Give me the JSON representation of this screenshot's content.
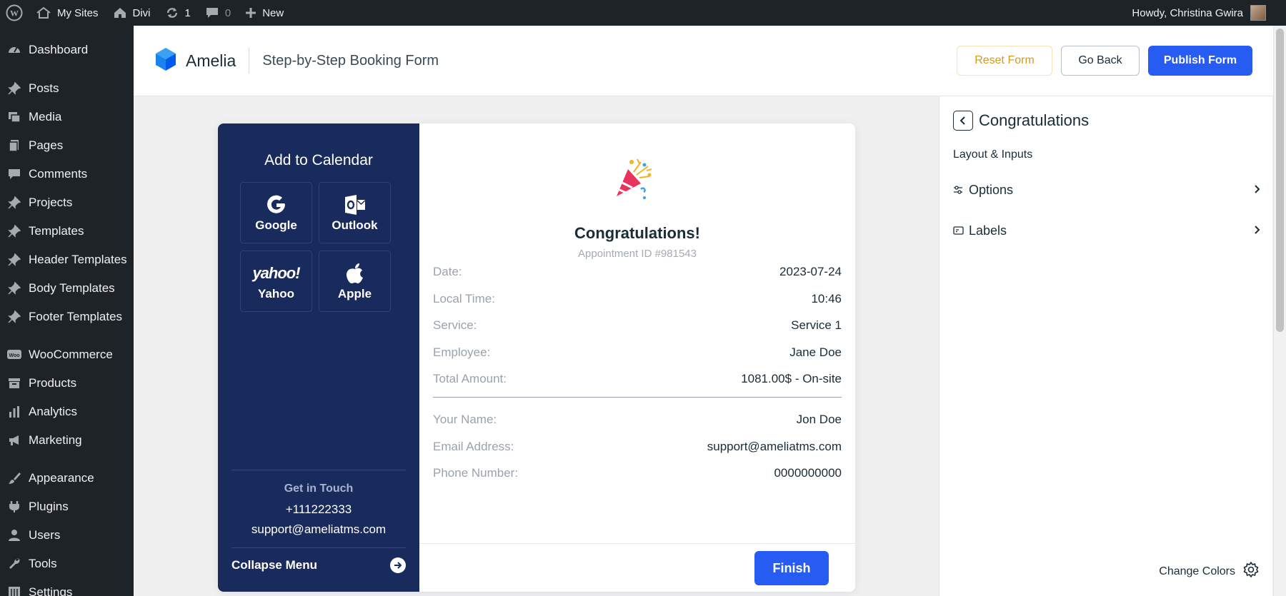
{
  "adminbar": {
    "my_sites": "My Sites",
    "site_name": "Divi",
    "updates_count": "1",
    "comments_count": "0",
    "new_label": "New",
    "howdy": "Howdy, Christina Gwira"
  },
  "sidebar": {
    "items": [
      {
        "label": "Dashboard",
        "icon": "dashboard-icon"
      },
      {
        "label": "Posts",
        "icon": "pin-icon"
      },
      {
        "label": "Media",
        "icon": "media-icon"
      },
      {
        "label": "Pages",
        "icon": "pages-icon"
      },
      {
        "label": "Comments",
        "icon": "comments-icon"
      },
      {
        "label": "Projects",
        "icon": "pin-icon"
      },
      {
        "label": "Templates",
        "icon": "pin-icon"
      },
      {
        "label": "Header Templates",
        "icon": "pin-icon"
      },
      {
        "label": "Body Templates",
        "icon": "pin-icon"
      },
      {
        "label": "Footer Templates",
        "icon": "pin-icon"
      },
      {
        "label": "WooCommerce",
        "icon": "woo-icon"
      },
      {
        "label": "Products",
        "icon": "archive-icon"
      },
      {
        "label": "Analytics",
        "icon": "bar-chart-icon"
      },
      {
        "label": "Marketing",
        "icon": "megaphone-icon"
      },
      {
        "label": "Appearance",
        "icon": "brush-icon"
      },
      {
        "label": "Plugins",
        "icon": "plug-icon"
      },
      {
        "label": "Users",
        "icon": "user-icon"
      },
      {
        "label": "Tools",
        "icon": "wrench-icon"
      },
      {
        "label": "Settings",
        "icon": "settings-icon"
      }
    ]
  },
  "header": {
    "brand": "Amelia",
    "page_title": "Step-by-Step Booking Form",
    "reset_label": "Reset Form",
    "back_label": "Go Back",
    "publish_label": "Publish Form"
  },
  "calendar": {
    "title": "Add to Calendar",
    "options": [
      {
        "label": "Google",
        "icon": "google-icon"
      },
      {
        "label": "Outlook",
        "icon": "outlook-icon"
      },
      {
        "label": "Yahoo",
        "logo_text": "yahoo!",
        "icon": "yahoo-icon"
      },
      {
        "label": "Apple",
        "icon": "apple-icon"
      }
    ],
    "get_in_touch": "Get in Touch",
    "phone": "+111222333",
    "email": "support@ameliatms.com",
    "collapse_label": "Collapse Menu"
  },
  "confirmation": {
    "title": "Congratulations!",
    "appointment_id": "Appointment ID #981543",
    "details": [
      {
        "label": "Date:",
        "value": "2023-07-24"
      },
      {
        "label": "Local Time:",
        "value": "10:46"
      },
      {
        "label": "Service:",
        "value": "Service 1"
      },
      {
        "label": "Employee:",
        "value": "Jane Doe"
      },
      {
        "label": "Total Amount:",
        "value": "1081.00$ - On-site"
      }
    ],
    "customer": [
      {
        "label": "Your Name:",
        "value": "Jon Doe"
      },
      {
        "label": "Email Address:",
        "value": "support@ameliatms.com"
      },
      {
        "label": "Phone Number:",
        "value": "0000000000"
      }
    ],
    "finish_label": "Finish"
  },
  "panel": {
    "title": "Congratulations",
    "subtitle": "Layout & Inputs",
    "options_label": "Options",
    "labels_label": "Labels",
    "change_colors": "Change Colors"
  },
  "colors": {
    "primary": "#265cf2",
    "sidebar_dark": "#1d2327",
    "card_side": "#192a5d",
    "reset_gold": "#d39b1d"
  }
}
